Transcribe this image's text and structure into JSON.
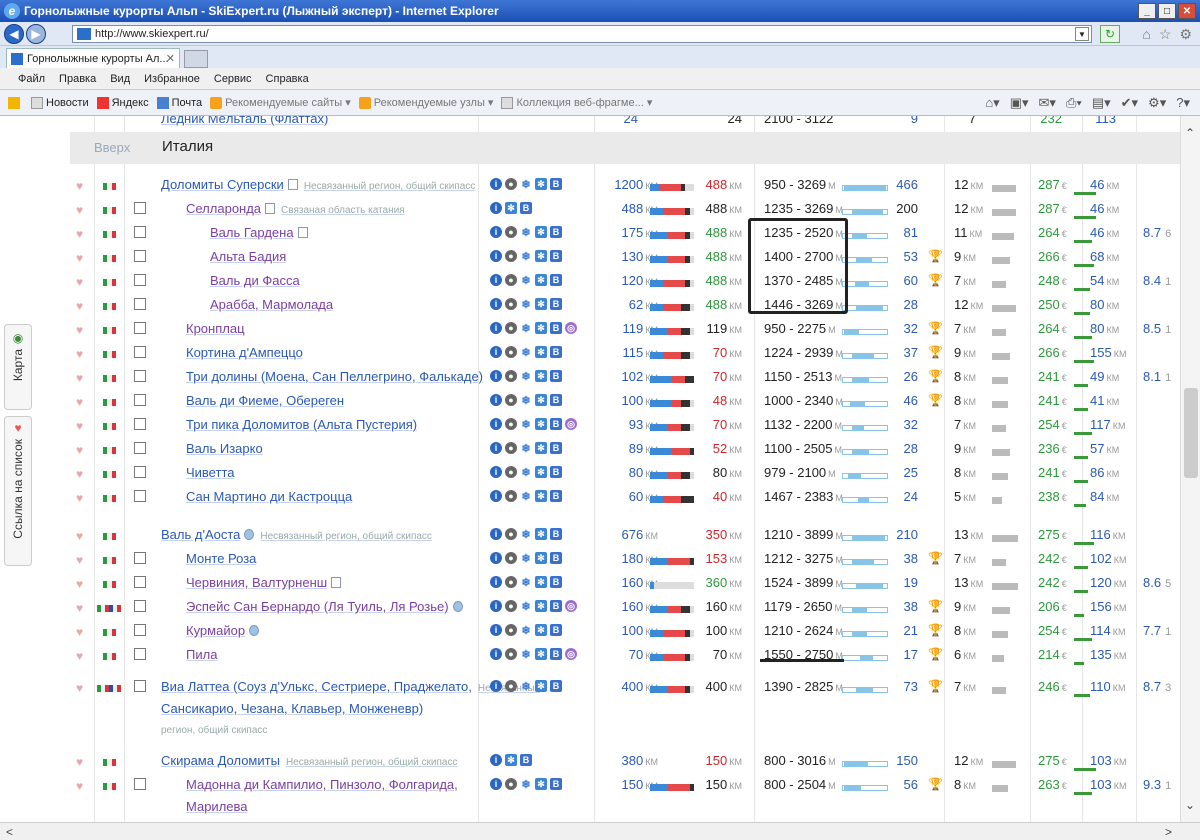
{
  "window": {
    "title": "Горнолыжные курорты Альп - SkiExpert.ru (Лыжный эксперт) - Internet Explorer"
  },
  "address": {
    "url": "http://www.skiexpert.ru/"
  },
  "tab": {
    "label": "Горнолыжные курорты Ал..."
  },
  "menu": [
    "Файл",
    "Правка",
    "Вид",
    "Избранное",
    "Сервис",
    "Справка"
  ],
  "favorites": [
    "Новости",
    "Яндекс",
    "Почта",
    "Рекомендуемые сайты ▾",
    "Рекомендуемые узлы ▾",
    "Коллекция веб-фрагме... ▾"
  ],
  "side": {
    "map": "Карта",
    "list": "Ссылка на список"
  },
  "top_cut": {
    "name": "Ледник Мёльталь (Флаттах)",
    "km1": "24",
    "km2": "24",
    "alt": "2100 - 3122",
    "lifts": "9",
    "km3": "7",
    "price": "232",
    "run": "113"
  },
  "section": {
    "up": "Вверх",
    "title": "Италия"
  },
  "units": {
    "km": "КМ",
    "m": "М",
    "eur": "€"
  },
  "rows": [
    {
      "name": "Доломиты Суперски",
      "desc": "Несвязанный регион, общий скипасс",
      "km1": "1200",
      "km2": "488",
      "alt": "950 - 3269",
      "lifts": "466",
      "km3": "12",
      "price": "287",
      "run": "46",
      "rating": "",
      "rating2": ""
    },
    {
      "name": "Селларонда",
      "desc": "Связаная область катания",
      "km1": "488",
      "km2": "488",
      "alt": "1235 - 3269",
      "lifts": "200",
      "km3": "12",
      "price": "287",
      "run": "46",
      "rating": "",
      "rating2": ""
    },
    {
      "name": "Валь Гардена",
      "desc": "",
      "km1": "175",
      "km2": "488",
      "alt": "1235 - 2520",
      "lifts": "81",
      "km3": "11",
      "price": "264",
      "run": "46",
      "rating": "8.7",
      "rating2": "6"
    },
    {
      "name": "Альта Бадия",
      "desc": "",
      "km1": "130",
      "km2": "488",
      "alt": "1400 - 2700",
      "lifts": "53",
      "km3": "9",
      "price": "266",
      "run": "68",
      "rating": "",
      "rating2": ""
    },
    {
      "name": "Валь ди Фасса",
      "desc": "",
      "km1": "120",
      "km2": "488",
      "alt": "1370 - 2485",
      "lifts": "60",
      "km3": "7",
      "price": "248",
      "run": "54",
      "rating": "8.4",
      "rating2": "1"
    },
    {
      "name": "Арабба, Мармолада",
      "desc": "",
      "km1": "62",
      "km2": "488",
      "alt": "1446 - 3269",
      "lifts": "28",
      "km3": "12",
      "price": "250",
      "run": "80",
      "rating": "",
      "rating2": ""
    },
    {
      "name": "Кронплац",
      "desc": "",
      "km1": "119",
      "km2": "119",
      "alt": "950 - 2275",
      "lifts": "32",
      "km3": "7",
      "price": "264",
      "run": "80",
      "rating": "8.5",
      "rating2": "1"
    },
    {
      "name": "Кортина д'Ампеццо",
      "desc": "",
      "km1": "115",
      "km2": "70",
      "alt": "1224 - 2939",
      "lifts": "37",
      "km3": "9",
      "price": "266",
      "run": "155",
      "rating": "",
      "rating2": ""
    },
    {
      "name": "Три долины (Моена, Сан Пеллегрино, Фалькаде)",
      "desc": "",
      "km1": "102",
      "km2": "70",
      "alt": "1150 - 2513",
      "lifts": "26",
      "km3": "8",
      "price": "241",
      "run": "49",
      "rating": "8.1",
      "rating2": "1"
    },
    {
      "name": "Валь ди Фиеме, Обереген",
      "desc": "",
      "km1": "100",
      "km2": "48",
      "alt": "1000 - 2340",
      "lifts": "46",
      "km3": "8",
      "price": "241",
      "run": "41",
      "rating": "",
      "rating2": ""
    },
    {
      "name": "Три пика Доломитов (Альта Пустерия)",
      "desc": "",
      "km1": "93",
      "km2": "70",
      "alt": "1132 - 2200",
      "lifts": "32",
      "km3": "7",
      "price": "254",
      "run": "117",
      "rating": "",
      "rating2": ""
    },
    {
      "name": "Валь Изарко",
      "desc": "",
      "km1": "89",
      "km2": "52",
      "alt": "1100 - 2505",
      "lifts": "28",
      "km3": "9",
      "price": "236",
      "run": "57",
      "rating": "",
      "rating2": ""
    },
    {
      "name": "Чиветта",
      "desc": "",
      "km1": "80",
      "km2": "80",
      "alt": "979 - 2100",
      "lifts": "25",
      "km3": "8",
      "price": "241",
      "run": "86",
      "rating": "",
      "rating2": ""
    },
    {
      "name": "Сан Мартино ди Кастроцца",
      "desc": "",
      "km1": "60",
      "km2": "40",
      "alt": "1467 - 2383",
      "lifts": "24",
      "km3": "5",
      "price": "238",
      "run": "84",
      "rating": "",
      "rating2": ""
    },
    {
      "name": "Валь д'Аоста",
      "desc": "Несвязанный регион, общий скипасс",
      "km1": "676",
      "km2": "350",
      "alt": "1210 - 3899",
      "lifts": "210",
      "km3": "13",
      "price": "275",
      "run": "116",
      "rating": "",
      "rating2": ""
    },
    {
      "name": "Монте Роза",
      "desc": "",
      "km1": "180",
      "km2": "153",
      "alt": "1212 - 3275",
      "lifts": "38",
      "km3": "7",
      "price": "242",
      "run": "102",
      "rating": "",
      "rating2": ""
    },
    {
      "name": "Червиния, Валтурненш",
      "desc": "",
      "km1": "160",
      "km2": "360",
      "alt": "1524 - 3899",
      "lifts": "19",
      "km3": "13",
      "price": "242",
      "run": "120",
      "rating": "8.6",
      "rating2": "5"
    },
    {
      "name": "Эспейс Сан Бернардо (Ля Туиль, Ля Розье)",
      "desc": "",
      "km1": "160",
      "km2": "160",
      "alt": "1179 - 2650",
      "lifts": "38",
      "km3": "9",
      "price": "206",
      "run": "156",
      "rating": "",
      "rating2": ""
    },
    {
      "name": "Курмайор",
      "desc": "",
      "km1": "100",
      "km2": "100",
      "alt": "1210 - 2624",
      "lifts": "21",
      "km3": "8",
      "price": "254",
      "run": "114",
      "rating": "7.7",
      "rating2": "1"
    },
    {
      "name": "Пила",
      "desc": "",
      "km1": "70",
      "km2": "70",
      "alt": "1550 - 2750",
      "lifts": "17",
      "km3": "6",
      "price": "214",
      "run": "135",
      "rating": "",
      "rating2": ""
    },
    {
      "name_line1": "Виа Латтеа (Соуз д'Улькс, Сестриере, Праджелато,",
      "name_line2": "Сансикарио, Чезана, Клавьер, Монженевр)",
      "desc": "Несвязанный",
      "desc2": "регион, общий скипасс",
      "km1": "400",
      "km2": "400",
      "alt": "1390 - 2825",
      "lifts": "73",
      "km3": "7",
      "price": "246",
      "run": "110",
      "rating": "8.7",
      "rating2": "3"
    },
    {
      "name": "Скирама Доломиты",
      "desc": "Несвязанный регион, общий скипасс",
      "km1": "380",
      "km2": "150",
      "alt": "800 - 3016",
      "lifts": "150",
      "km3": "12",
      "price": "275",
      "run": "103",
      "rating": "",
      "rating2": ""
    },
    {
      "name_line1": "Мадонна ди Кампилио, Пинзоло, Фолгарида,",
      "name_line2": "Марилева",
      "desc": "",
      "km1": "150",
      "km2": "150",
      "alt": "800 - 2504",
      "lifts": "56",
      "km3": "8",
      "price": "263",
      "run": "103",
      "rating": "9.3",
      "rating2": "1"
    }
  ]
}
